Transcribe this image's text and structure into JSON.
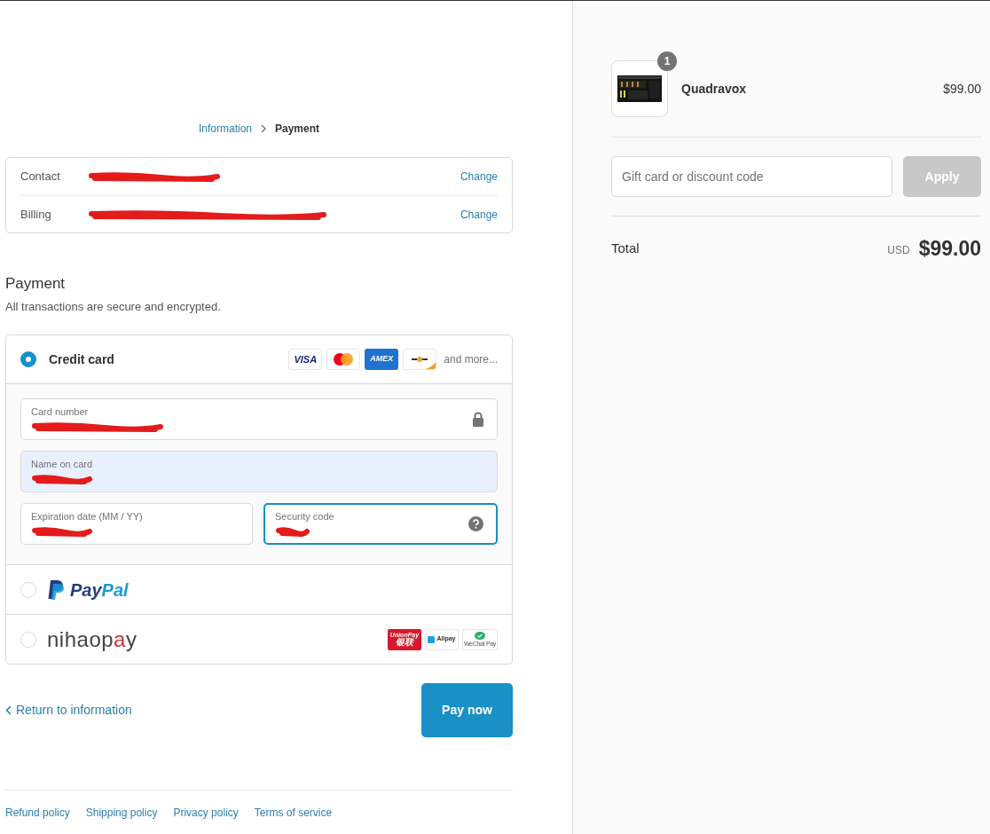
{
  "breadcrumb": [
    {
      "label": "Information",
      "selected": false
    },
    {
      "label": "Payment",
      "selected": true
    }
  ],
  "review": [
    {
      "label": "Contact",
      "redacted": true,
      "action": "Change"
    },
    {
      "label": "Billing",
      "redacted": true,
      "action": "Change"
    }
  ],
  "payment": {
    "title": "Payment",
    "subtitle": "All transactions are secure and encrypted.",
    "methods": [
      {
        "kind": "card",
        "label": "Credit card",
        "selected": true,
        "brands": [
          {
            "kind": "visa",
            "text": "VISA"
          },
          {
            "kind": "mastercard"
          },
          {
            "kind": "amex",
            "text": "AMEX"
          },
          {
            "kind": "generic"
          }
        ],
        "more": "and more...",
        "field_rows": [
          [
            {
              "kind": "card_number",
              "label": "Card number",
              "redacted": true,
              "autofilled": false,
              "focused": false
            }
          ],
          [
            {
              "kind": "name",
              "label": "Name on card",
              "redacted": true,
              "autofilled": true,
              "focused": false
            }
          ],
          [
            {
              "kind": "expiry",
              "label": "Expiration date (MM / YY)",
              "redacted": true,
              "autofilled": false,
              "focused": false
            },
            {
              "kind": "security_code",
              "label": "Security code",
              "redacted": true,
              "autofilled": false,
              "focused": true
            }
          ]
        ]
      },
      {
        "kind": "paypal",
        "selected": false,
        "logo": [
          "Pay",
          "Pal"
        ]
      },
      {
        "kind": "nihaopay",
        "selected": false,
        "logo": [
          "nihao",
          "p",
          "a",
          "y"
        ],
        "badges": [
          {
            "kind": "unionpay",
            "text": "UnionPay",
            "text2": "银联"
          },
          {
            "kind": "alipay",
            "text": "Alipay"
          },
          {
            "kind": "wechat",
            "text": "WeChat Pay"
          }
        ]
      }
    ]
  },
  "back_link": "Return to information",
  "pay_button": "Pay now",
  "footer_links": [
    "Refund policy",
    "Shipping policy",
    "Privacy policy",
    "Terms of service"
  ],
  "summary": {
    "items": [
      {
        "name": "Quadravox",
        "quantity": "1",
        "price": "$99.00"
      }
    ],
    "discount": {
      "placeholder": "Gift card or discount code",
      "button": "Apply",
      "disabled": true
    },
    "total": {
      "label": "Total",
      "currency": "USD",
      "amount": "$99.00"
    }
  }
}
